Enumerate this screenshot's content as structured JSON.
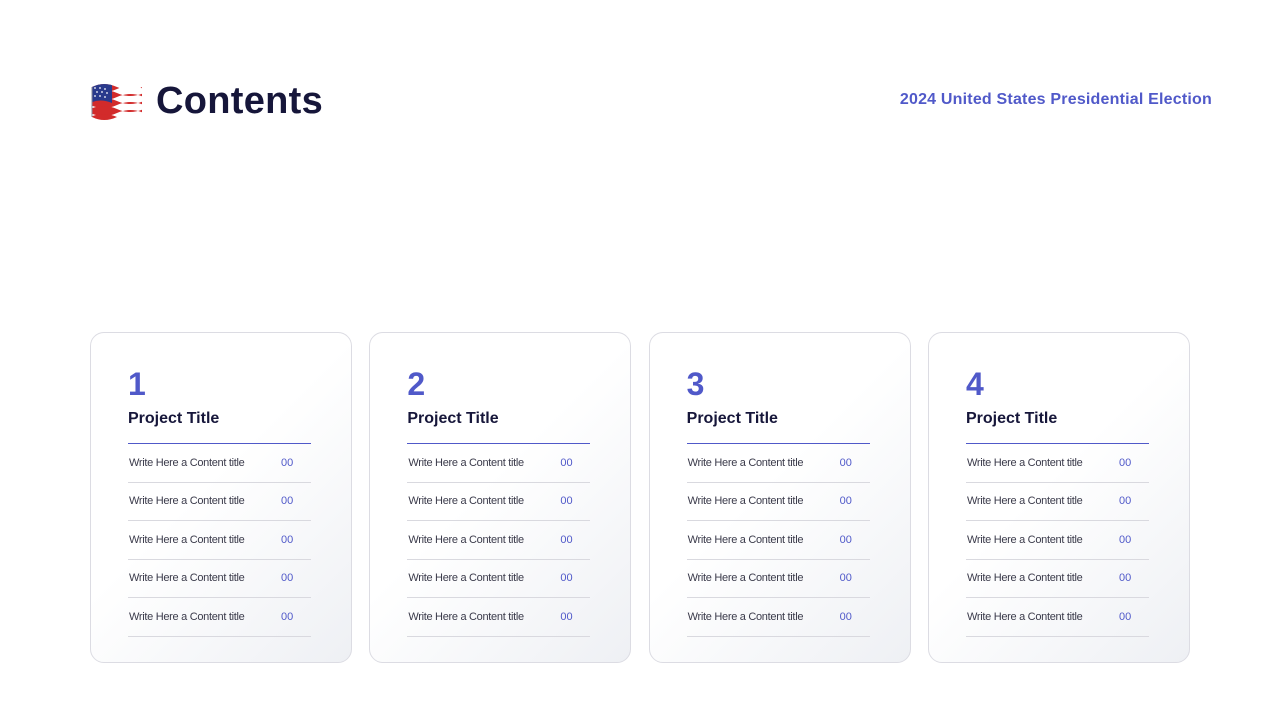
{
  "header": {
    "title": "Contents",
    "subtitle": "2024 United States Presidential Election",
    "flag_icon": "us-flag-icon"
  },
  "colors": {
    "accent": "#5059c9",
    "title": "#16163a",
    "border": "#dcdce3"
  },
  "cards": [
    {
      "number": "1",
      "title": "Project Title",
      "items": [
        {
          "text": "Write Here a Content title",
          "page": "00"
        },
        {
          "text": "Write Here a Content title",
          "page": "00"
        },
        {
          "text": "Write Here a Content title",
          "page": "00"
        },
        {
          "text": "Write Here a Content title",
          "page": "00"
        },
        {
          "text": "Write Here a Content title",
          "page": "00"
        }
      ]
    },
    {
      "number": "2",
      "title": "Project Title",
      "items": [
        {
          "text": "Write Here a Content title",
          "page": "00"
        },
        {
          "text": "Write Here a Content title",
          "page": "00"
        },
        {
          "text": "Write Here a Content title",
          "page": "00"
        },
        {
          "text": "Write Here a Content title",
          "page": "00"
        },
        {
          "text": "Write Here a Content title",
          "page": "00"
        }
      ]
    },
    {
      "number": "3",
      "title": "Project Title",
      "items": [
        {
          "text": "Write Here a Content title",
          "page": "00"
        },
        {
          "text": "Write Here a Content title",
          "page": "00"
        },
        {
          "text": "Write Here a Content title",
          "page": "00"
        },
        {
          "text": "Write Here a Content title",
          "page": "00"
        },
        {
          "text": "Write Here a Content title",
          "page": "00"
        }
      ]
    },
    {
      "number": "4",
      "title": "Project Title",
      "items": [
        {
          "text": "Write Here a Content title",
          "page": "00"
        },
        {
          "text": "Write Here a Content title",
          "page": "00"
        },
        {
          "text": "Write Here a Content title",
          "page": "00"
        },
        {
          "text": "Write Here a Content title",
          "page": "00"
        },
        {
          "text": "Write Here a Content title",
          "page": "00"
        }
      ]
    }
  ]
}
